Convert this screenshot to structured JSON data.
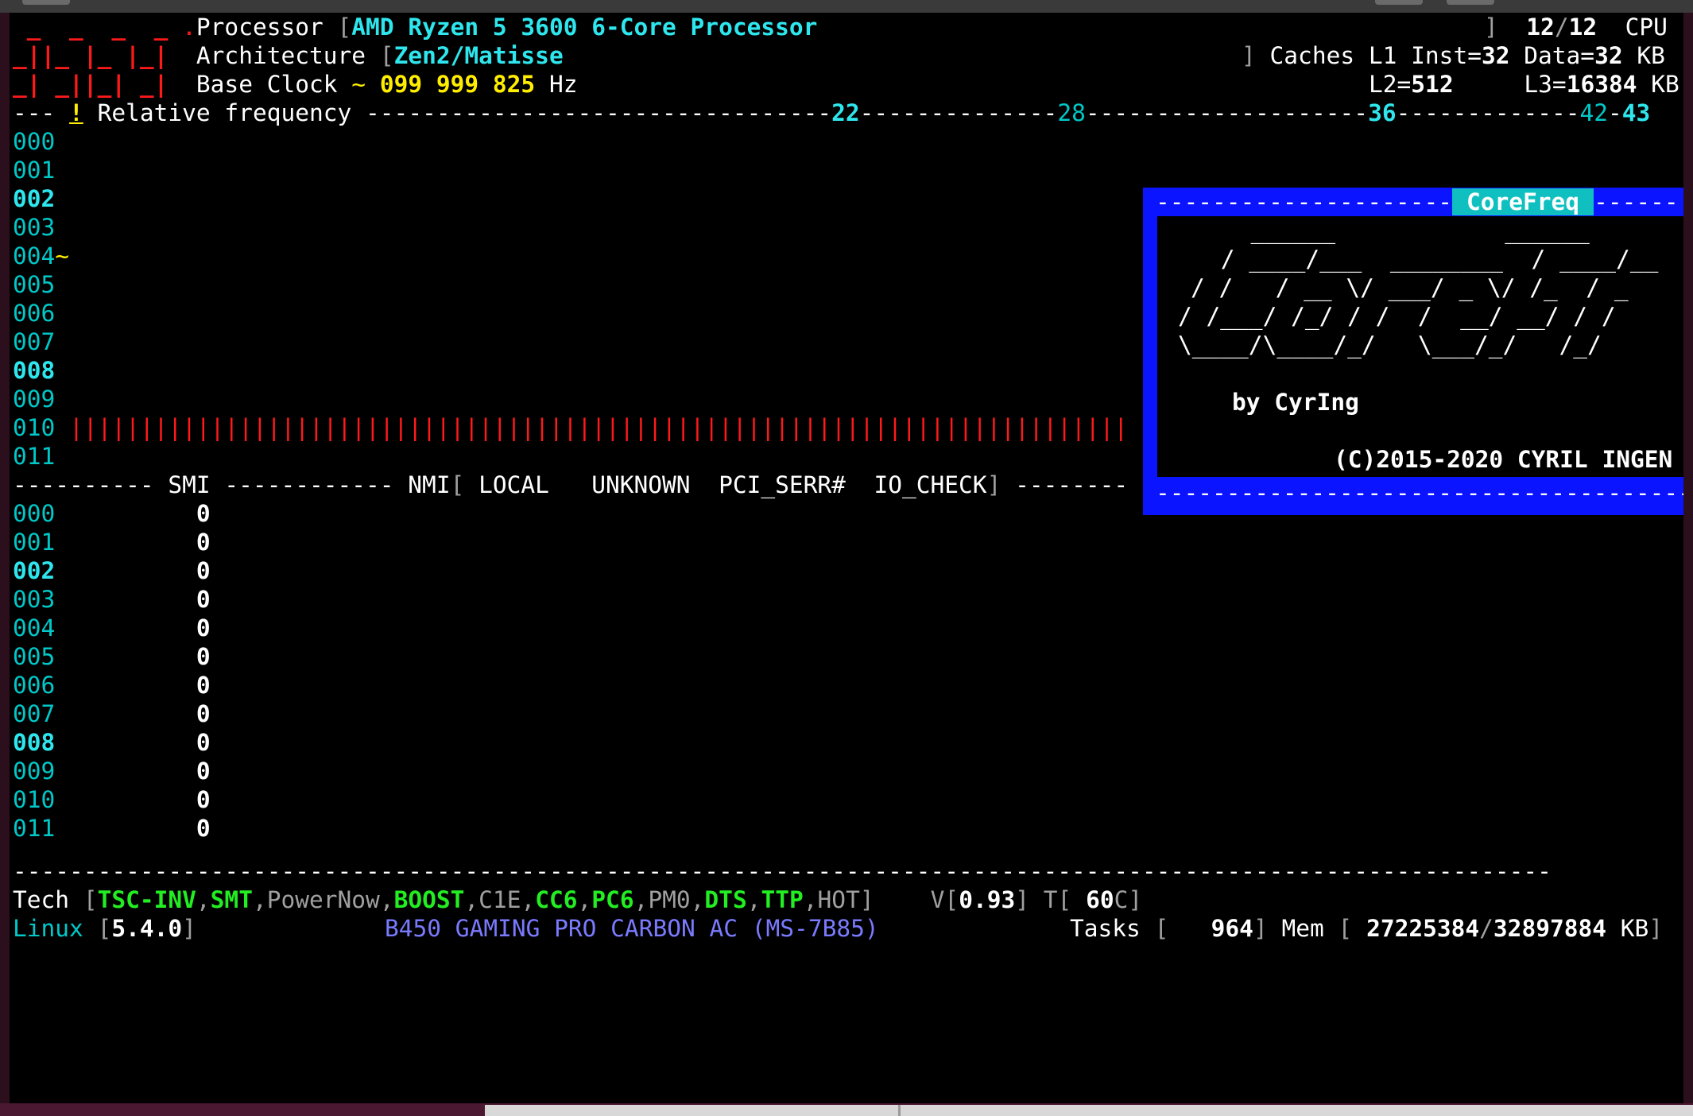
{
  "logo": {
    "row1": " _  _  _  _ ",
    "row2": "_||_ |_ |_|",
    "row3": "_| _||_| _|",
    "dot": "."
  },
  "header": {
    "processor_label": "Processor",
    "processor_value": "AMD Ryzen 5 3600 6-Core Processor",
    "cpu_count": "12",
    "cpu_total": "12",
    "cpu_label": "CPU",
    "architecture_label": "Architecture",
    "architecture_value": "Zen2/Matisse",
    "caches_label": "Caches",
    "l1_inst_label": "L1 Inst=",
    "l1_inst_value": "32",
    "l1_data_label": "Data=",
    "l1_data_value": "32",
    "kb1": "KB",
    "base_clock_label": "Base Clock",
    "base_clock_tilde": "~",
    "base_clock_value": "099 999 825",
    "hz": "Hz",
    "l2_label": "L2=",
    "l2_value": "512",
    "l3_label": "L3=",
    "l3_value": "16384",
    "kb2": "KB"
  },
  "freq_header": {
    "lead": "--- ",
    "bang": "!",
    "label": " Relative frequency ",
    "mark_22": "22",
    "mark_28": "28",
    "mark_36": "36",
    "mark_42": "42",
    "mark_43": "43"
  },
  "cores": [
    {
      "id": "000",
      "marker": ""
    },
    {
      "id": "001",
      "marker": ""
    },
    {
      "id": "002",
      "marker": ""
    },
    {
      "id": "003",
      "marker": ""
    },
    {
      "id": "004",
      "marker": "~"
    },
    {
      "id": "005",
      "marker": ""
    },
    {
      "id": "006",
      "marker": ""
    },
    {
      "id": "007",
      "marker": ""
    },
    {
      "id": "008",
      "marker": ""
    },
    {
      "id": "009",
      "marker": ""
    },
    {
      "id": "010",
      "marker": ""
    },
    {
      "id": "011",
      "marker": ""
    }
  ],
  "freq_bar_010": "|||||||||||||||||||||||||||||||||||||||||||||||||||||||||||||||||||||||||||",
  "smi_header": {
    "lead": "---------- SMI ------------ NMI",
    "local": "LOCAL",
    "unknown": "UNKNOWN",
    "pci_serr": "PCI_SERR#",
    "io_check": "IO_CHECK",
    "trail": "--------"
  },
  "smi_values": [
    "0",
    "0",
    "0",
    "0",
    "0",
    "0",
    "0",
    "0",
    "0",
    "0",
    "0",
    "0"
  ],
  "tech": {
    "label": "Tech",
    "items": [
      {
        "name": "TSC-INV",
        "enabled": true
      },
      {
        "name": "SMT",
        "enabled": true
      },
      {
        "name": "PowerNow",
        "enabled": false
      },
      {
        "name": "BOOST",
        "enabled": true
      },
      {
        "name": "C1E",
        "enabled": false
      },
      {
        "name": "CC6",
        "enabled": true
      },
      {
        "name": "PC6",
        "enabled": true
      },
      {
        "name": "PM0",
        "enabled": false
      },
      {
        "name": "DTS",
        "enabled": true
      },
      {
        "name": "TTP",
        "enabled": true
      },
      {
        "name": "HOT",
        "enabled": false
      }
    ],
    "voltage_label": "V",
    "voltage": "0.93",
    "temp_label": "T",
    "temp": "60",
    "temp_unit": "C"
  },
  "system": {
    "os_label": "Linux",
    "kernel": "5.4.0",
    "board": "B450 GAMING PRO CARBON AC (MS-7B85)",
    "tasks_label": "Tasks",
    "tasks": "964",
    "mem_label": "Mem",
    "mem_used": "27225384",
    "mem_total": "32897884",
    "mem_unit": "KB"
  },
  "about": {
    "title": "CoreFreq",
    "art1": "  ______            ______",
    "art2": " / ____/___  ________  / ____/__",
    "art3": "/ /   / __ \\/ ___/ _ \\/ /_  / _",
    "art4": "/ /___/ /_/ / /  /  __/ __/ / /",
    "art5": "\\____/\\____/_/   \\___/_/   /_/",
    "byline": "by CyrIng",
    "copyright": "(C)2015-2020 CYRIL INGEN"
  },
  "colors": {
    "terminal_bg": "#000000",
    "accent_cyan": "#2ee7ee",
    "logo_red": "#ff1a1a",
    "popup_blue": "#0a14ff",
    "popup_title_bg": "#10c0c0",
    "enabled_green": "#22ee22",
    "board_blue": "#7a7aff",
    "yellow": "#ffee00"
  }
}
